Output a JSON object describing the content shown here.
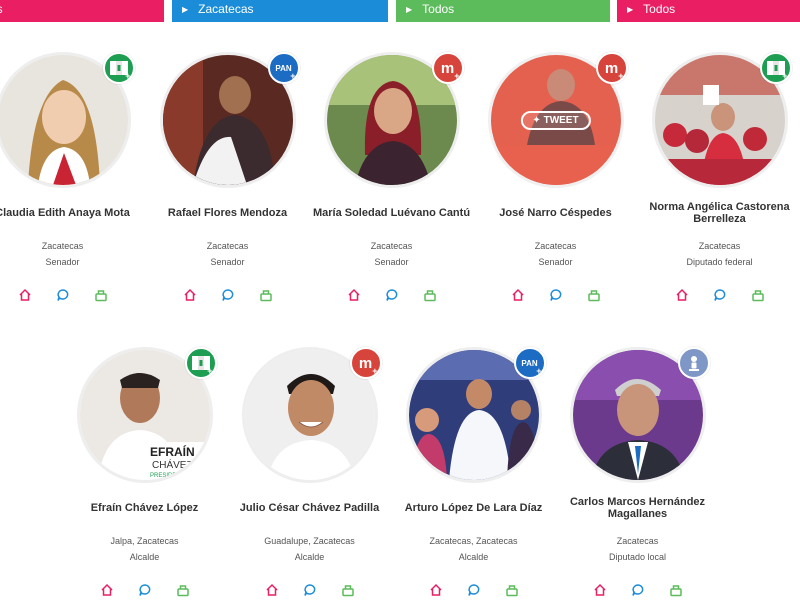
{
  "filters": [
    {
      "label": "os"
    },
    {
      "label": "Zacatecas"
    },
    {
      "label": "Todos"
    },
    {
      "label": "Todos"
    }
  ],
  "colors": {
    "pink": "#e91e63",
    "blue": "#1b8dd8",
    "green": "#5cbb5b",
    "pri": "#1e9e52",
    "pan": "#1b6cc2",
    "morena": "#d7443b"
  },
  "party_labels": {
    "pan": "PAN",
    "morena": "m",
    "plus": "+"
  },
  "tweet_label": "TWEET",
  "candidates": [
    {
      "name": "Claudia Edith Anaya Mota",
      "place": "Zacatecas",
      "role": "Senador",
      "party": "pri-icon"
    },
    {
      "name": "Rafael Flores Mendoza",
      "place": "Zacatecas",
      "role": "Senador",
      "party": "pan-icon"
    },
    {
      "name": "María Soledad Luévano Cantú",
      "place": "Zacatecas",
      "role": "Senador",
      "party": "morena-icon"
    },
    {
      "name": "José Narro Céspedes",
      "place": "Zacatecas",
      "role": "Senador",
      "party": "morena-icon"
    },
    {
      "name": "Norma Angélica Castorena Berrelleza",
      "place": "Zacatecas",
      "role": "Diputado federal",
      "party": "pri-icon"
    },
    {
      "name": "Efraín Chávez López",
      "place": "Jalpa, Zacatecas",
      "role": "Alcalde",
      "party": "pri-icon"
    },
    {
      "name": "Julio César Chávez Padilla",
      "place": "Guadalupe, Zacatecas",
      "role": "Alcalde",
      "party": "morena-icon"
    },
    {
      "name": "Arturo López De Lara Díaz",
      "place": "Zacatecas, Zacatecas",
      "role": "Alcalde",
      "party": "pan-icon"
    },
    {
      "name": "Carlos Marcos Hernández Magallanes",
      "place": "Zacatecas",
      "role": "Diputado local",
      "party": "independent-icon"
    }
  ],
  "photo_sign": {
    "line1": "EFRAÍN",
    "line2": "CHÁVEZ",
    "line3": "PRESIDENTE M"
  }
}
